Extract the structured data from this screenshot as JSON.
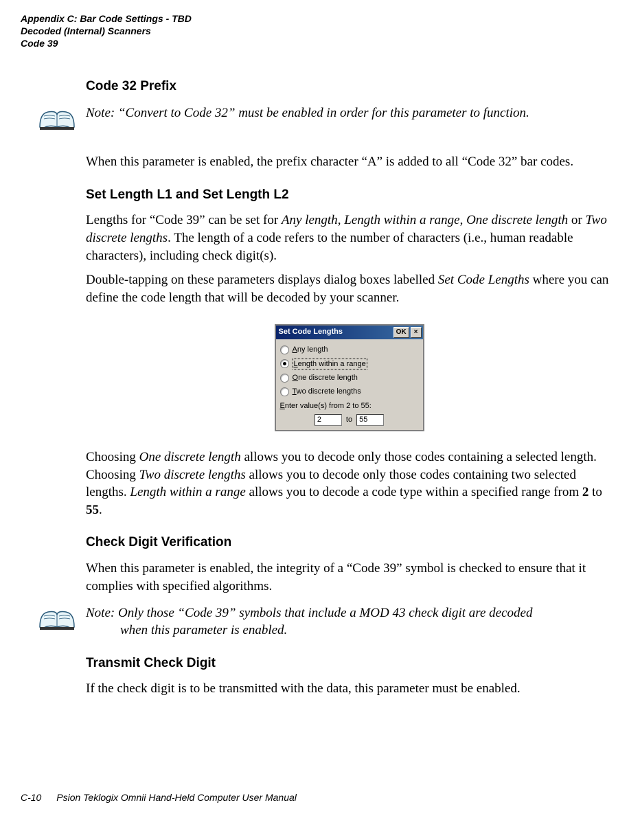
{
  "header": {
    "line1": "Appendix C: Bar Code Settings - TBD",
    "line2": "Decoded (Internal) Scanners",
    "line3": "Code 39"
  },
  "headings": {
    "code32prefix": "Code 32 Prefix",
    "setlength": "Set Length L1 and Set Length L2",
    "checkdigit": "Check Digit Verification",
    "transmit": "Transmit Check Digit"
  },
  "notes": {
    "note1_label": "Note:",
    "note1_text": "“Convert to Code 32” must be enabled in order for this parameter to function.",
    "note2_label": "Note:",
    "note2_text_line1": "Only those “Code 39” symbols that include a MOD 43 check digit are decoded",
    "note2_text_line2": "when this parameter is enabled."
  },
  "body": {
    "p1": "When this parameter is enabled, the prefix character “A” is added to all “Code 32” bar codes.",
    "p2_a": "Lengths for “Code 39” can be set for ",
    "p2_i1": "Any length",
    "p2_b": ", ",
    "p2_i2": "Length within a range",
    "p2_c": ", ",
    "p2_i3": "One discrete length",
    "p2_d": " or ",
    "p2_i4": "Two discrete lengths",
    "p2_e": ". The length of a code refers to the number of characters (i.e., human readable characters), including check digit(s).",
    "p3_a": "Double-tapping on these parameters displays dialog boxes labelled ",
    "p3_i1": "Set Code Lengths",
    "p3_b": " where you can define the code length that will be decoded by your scanner.",
    "p4_a": "Choosing ",
    "p4_i1": "One discrete length",
    "p4_b": " allows you to decode only those codes containing a selected length. Choosing ",
    "p4_i2": "Two discrete lengths",
    "p4_c": " allows you to decode only those codes containing two selected lengths. ",
    "p4_i3": "Length within a range",
    "p4_d": " allows you to decode a code type within a specified range from ",
    "p4_b1": "2",
    "p4_e": " to ",
    "p4_b2": "55",
    "p4_f": ".",
    "p5": "When this parameter is enabled, the integrity of a “Code 39” symbol is checked to ensure that it complies with specified algorithms.",
    "p6": "If the check digit is to be transmitted with the data, this parameter must be enabled."
  },
  "dialog": {
    "title": "Set Code Lengths",
    "ok": "OK",
    "close": "×",
    "opt1_u": "A",
    "opt1_r": "ny length",
    "opt2_u": "L",
    "opt2_r": "ength within a range",
    "opt3_u": "O",
    "opt3_r": "ne discrete length",
    "opt4_u": "T",
    "opt4_r": "wo discrete lengths",
    "range_label_u": "E",
    "range_label_r": "nter value(s) from 2 to 55:",
    "from": "2",
    "to_label": "to",
    "to": "55"
  },
  "footer": {
    "page": "C-10",
    "title": "Psion Teklogix Omnii Hand-Held Computer User Manual"
  }
}
